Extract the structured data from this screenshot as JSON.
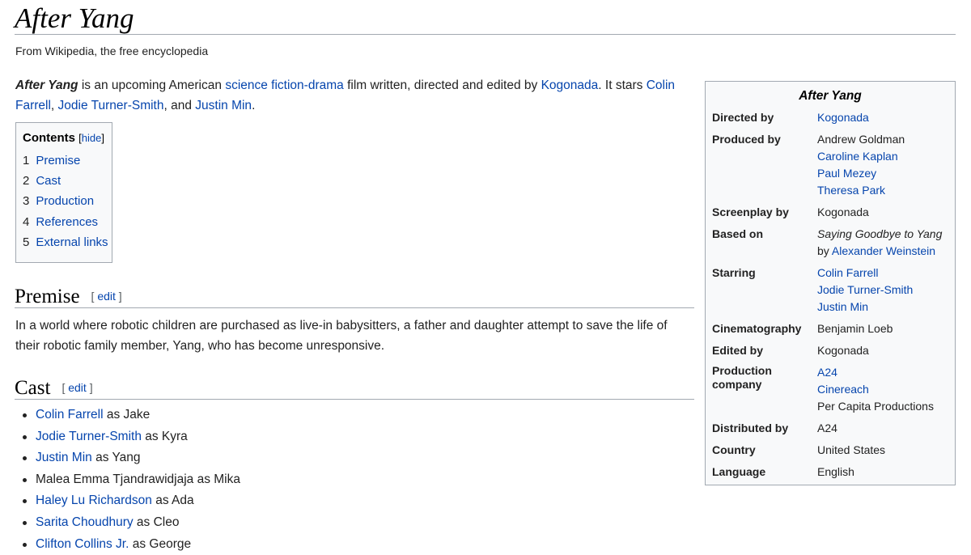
{
  "page": {
    "title": "After Yang",
    "tagline": "From Wikipedia, the free encyclopedia"
  },
  "lead": {
    "title_bold": "After Yang",
    "t1": " is an upcoming American ",
    "link_genre": "science fiction-drama",
    "t2": " film written, directed and edited by ",
    "link_director": "Kogonada",
    "t3": ". It stars ",
    "link_star1": "Colin Farrell",
    "t4": ", ",
    "link_star2": "Jodie Turner-Smith",
    "t5": ", and ",
    "link_star3": "Justin Min",
    "t6": "."
  },
  "toc": {
    "heading": "Contents",
    "hide_open": "[",
    "hide_label": "hide",
    "hide_close": "]",
    "items": [
      {
        "num": "1",
        "label": "Premise"
      },
      {
        "num": "2",
        "label": "Cast"
      },
      {
        "num": "3",
        "label": "Production"
      },
      {
        "num": "4",
        "label": "References"
      },
      {
        "num": "5",
        "label": "External links"
      }
    ]
  },
  "premise": {
    "heading": "Premise",
    "edit_open": "[ ",
    "edit_label": "edit",
    "edit_close": " ]",
    "text": "In a world where robotic children are purchased as live-in babysitters, a father and daughter attempt to save the life of their robotic family member, Yang, who has become unresponsive."
  },
  "cast": {
    "heading": "Cast",
    "edit_open": "[ ",
    "edit_label": "edit",
    "edit_close": " ]",
    "items": [
      {
        "actor": "Colin Farrell",
        "role": " as Jake"
      },
      {
        "actor": "Jodie Turner-Smith",
        "role": " as Kyra"
      },
      {
        "actor": "Justin Min",
        "role": " as Yang"
      },
      {
        "actor": "Malea Emma Tjandrawidjaja",
        "role": " as Mika"
      },
      {
        "actor": "Haley Lu Richardson",
        "role": " as Ada"
      },
      {
        "actor": "Sarita Choudhury",
        "role": " as Cleo"
      },
      {
        "actor": "Clifton Collins Jr.",
        "role": " as George"
      }
    ]
  },
  "infobox": {
    "title": "After Yang",
    "directed_by_label": "Directed by",
    "directed_by": "Kogonada",
    "produced_by_label": "Produced by",
    "producers": [
      "Andrew Goldman",
      "Caroline Kaplan",
      "Paul Mezey",
      "Theresa Park"
    ],
    "screenplay_by_label": "Screenplay by",
    "screenplay_by": "Kogonada",
    "based_on_label": "Based on",
    "based_on_work": "Saying Goodbye to Yang",
    "based_on_by": "by ",
    "based_on_author": "Alexander Weinstein",
    "starring_label": "Starring",
    "starring": [
      "Colin Farrell",
      "Jodie Turner-Smith",
      "Justin Min"
    ],
    "cinematography_label": "Cinematography",
    "cinematography": "Benjamin Loeb",
    "edited_by_label": "Edited by",
    "edited_by": "Kogonada",
    "production_company_label": "Production company",
    "production_companies": [
      "A24",
      "Cinereach",
      "Per Capita Productions"
    ],
    "distributed_by_label": "Distributed by",
    "distributed_by": "A24",
    "country_label": "Country",
    "country": "United States",
    "language_label": "Language",
    "language": "English"
  },
  "colors": {
    "link": "#0645ad",
    "text": "#222222",
    "rule": "#a2a9b1",
    "box_bg": "#f8f9fa"
  }
}
